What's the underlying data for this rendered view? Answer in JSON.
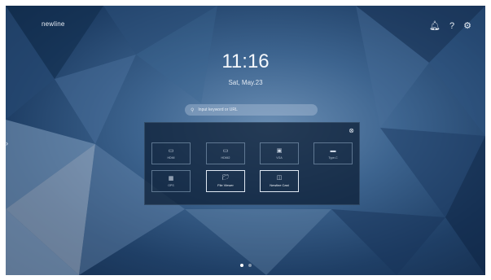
{
  "brand": "newline",
  "top_icons": [
    "bell-icon",
    "help-icon",
    "settings-icon"
  ],
  "clock": {
    "time": "11:16",
    "date": "Sat, May.23"
  },
  "search": {
    "placeholder": "Input keyword or URL"
  },
  "sources": [
    {
      "label": "HDMI",
      "icon": "hdmi-icon"
    },
    {
      "label": "HDMI2",
      "icon": "hdmi-icon"
    },
    {
      "label": "VGA",
      "icon": "vga-icon"
    },
    {
      "label": "Type-C",
      "icon": "usb-c-icon"
    },
    {
      "label": "OPS",
      "icon": "ops-icon"
    },
    {
      "label": "File Viewer",
      "icon": "folder-icon"
    },
    {
      "label": "Newline Cast",
      "icon": "cast-icon"
    }
  ],
  "pages": {
    "current": 1,
    "total": 2
  },
  "colors": {
    "background": "#2c5078",
    "panel": "#0c1e34",
    "text": "#f4f7fb"
  }
}
